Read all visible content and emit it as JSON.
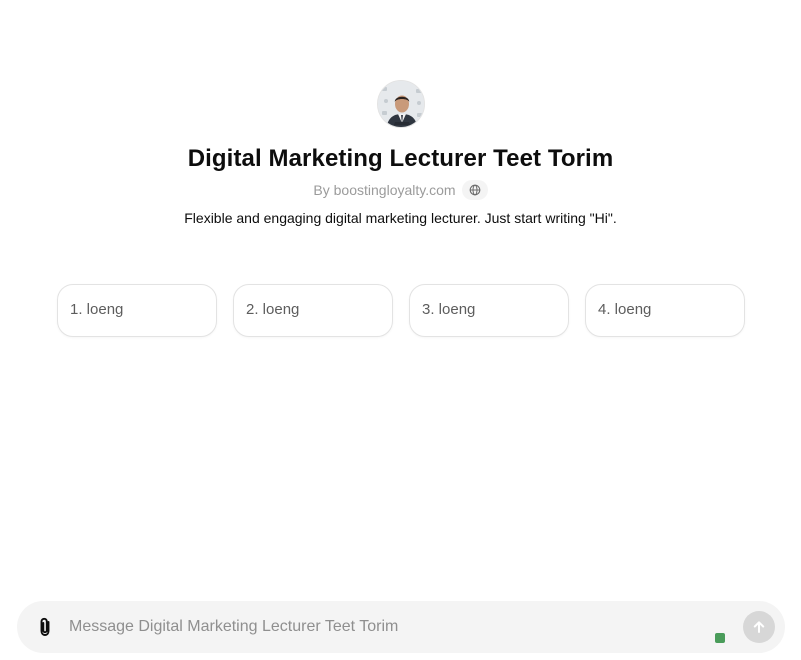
{
  "gpt": {
    "name": "Digital Marketing Lecturer Teet Torim",
    "author": "By boostingloyalty.com",
    "description": "Flexible and engaging digital marketing lecturer. Just start writing \"Hi\".",
    "avatar_icon": "person-portrait-avatar",
    "website_icon": "globe-icon"
  },
  "starters": [
    {
      "label": "1. loeng"
    },
    {
      "label": "2. loeng"
    },
    {
      "label": "3. loeng"
    },
    {
      "label": "4. loeng"
    }
  ],
  "composer": {
    "placeholder": "Message Digital Marketing Lecturer Teet Torim",
    "value": "",
    "attach_icon": "paperclip-icon",
    "send_icon": "arrow-up-icon",
    "status_color": "#4a9c5a"
  }
}
